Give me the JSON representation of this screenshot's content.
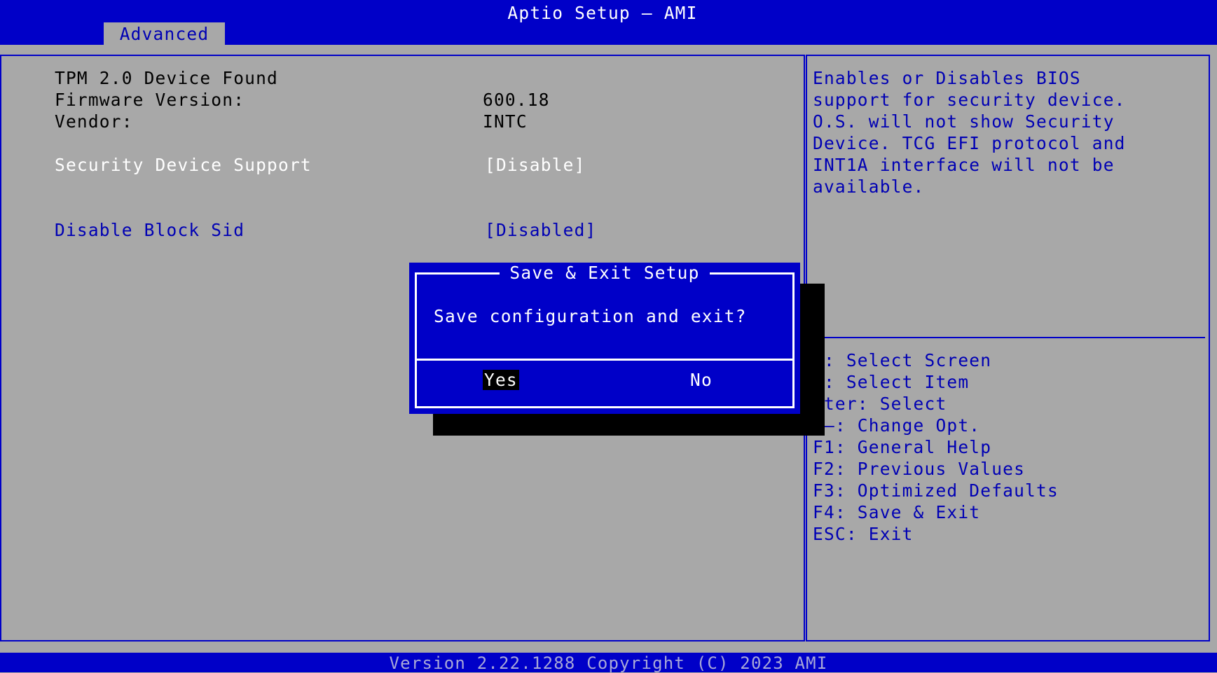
{
  "header": {
    "title": "Aptio Setup – AMI",
    "tab": "Advanced"
  },
  "main": {
    "device_found": "TPM 2.0 Device Found",
    "firmware_label": "Firmware Version:",
    "firmware_value": "600.18",
    "vendor_label": "Vendor:",
    "vendor_value": "INTC",
    "security_label": "Security Device Support",
    "security_value": "[Disable]",
    "block_sid_label": "Disable Block Sid",
    "block_sid_value": "[Disabled]"
  },
  "help": {
    "lines": [
      "Enables or Disables BIOS",
      "support for security device.",
      "O.S. will not show Security",
      "Device. TCG EFI protocol and",
      "INT1A interface will not be",
      "available."
    ]
  },
  "keys": [
    "←: Select Screen",
    "↓: Select Item",
    "nter: Select",
    "/–: Change Opt.",
    "F1: General Help",
    "F2: Previous Values",
    "F3: Optimized Defaults",
    "F4: Save & Exit",
    "ESC: Exit"
  ],
  "dialog": {
    "title": "Save & Exit Setup",
    "message": "Save configuration and exit?",
    "yes": "Yes",
    "no": "No"
  },
  "footer": {
    "version": "Version 2.22.1288 Copyright (C) 2023 AMI"
  },
  "colors": {
    "background": "#a8a8a8",
    "accent_blue": "#0000c8",
    "text_blue": "#0000b4",
    "selected_white": "#ffffff"
  }
}
